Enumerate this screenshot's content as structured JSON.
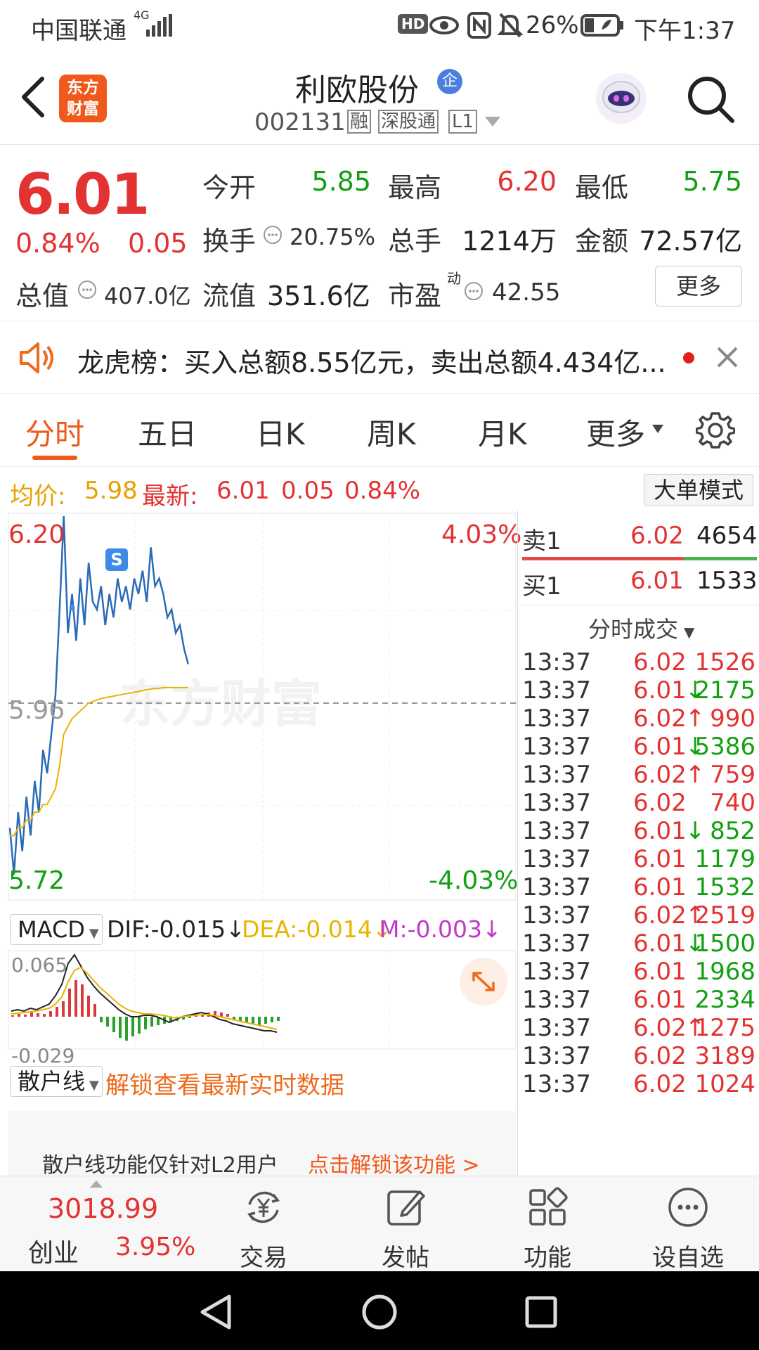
{
  "status_bar": {
    "carrier": "中国联通",
    "net": "4G",
    "battery": "26%",
    "time": "下午1:37",
    "hd": "HD"
  },
  "header": {
    "title": "利欧股份",
    "badge": "企",
    "code": "002131",
    "tags": [
      "融",
      "深股通",
      "L1"
    ],
    "logo_line1": "东方",
    "logo_line2": "财富"
  },
  "quote": {
    "price": "6.01",
    "change_pct": "0.84%",
    "change": "0.05",
    "open_label": "今开",
    "open": "5.85",
    "high_label": "最高",
    "high": "6.20",
    "low_label": "最低",
    "low": "5.75",
    "turnover_label": "换手",
    "turnover": "20.75%",
    "volume_label": "总手",
    "volume": "1214万",
    "amount_label": "金额",
    "amount": "72.57亿",
    "mcap_label": "总值",
    "mcap": "407.0亿",
    "float_label": "流值",
    "float": "351.6亿",
    "pe_label": "市盈",
    "pe_sup": "动",
    "pe": "42.55",
    "more": "更多"
  },
  "notice": {
    "text": "龙虎榜：买入总额8.55亿元，卖出总额4.434亿..."
  },
  "tabs": [
    "分时",
    "五日",
    "日K",
    "周K",
    "月K",
    "更多"
  ],
  "info": {
    "avg_label": "均价:",
    "avg": "5.98",
    "latest_label": "最新:",
    "latest": "6.01",
    "change": "0.05",
    "pct": "0.84%",
    "big_order": "大单模式"
  },
  "chart_labels": {
    "top_price": "6.20",
    "top_pct": "4.03%",
    "mid": "5.96",
    "bot_price": "5.72",
    "bot_pct": "-4.03%",
    "s_marker": "S",
    "watermark": "东方财富"
  },
  "macd": {
    "name": "MACD",
    "dif": "DIF:-0.015",
    "dea": "DEA:-0.014",
    "m": "M:-0.003",
    "top": "0.065",
    "bottom": "-0.029"
  },
  "retail": {
    "name": "散户线",
    "unlock": "解锁查看最新实时数据",
    "msg": "散户线功能仅针对L2用户",
    "link": "点击解锁该功能 >"
  },
  "order_book": {
    "sell1_label": "卖1",
    "sell1_price": "6.02",
    "sell1_vol": "4654",
    "buy1_label": "买1",
    "buy1_price": "6.01",
    "buy1_vol": "1533",
    "trades_header": "分时成交"
  },
  "trades": [
    {
      "time": "13:37",
      "price": "6.02",
      "arrow": "",
      "vol": "1526",
      "color": "red"
    },
    {
      "time": "13:37",
      "price": "6.01",
      "arrow": "↓",
      "vol": "2175",
      "color": "green"
    },
    {
      "time": "13:37",
      "price": "6.02",
      "arrow": "↑",
      "vol": "990",
      "color": "red"
    },
    {
      "time": "13:37",
      "price": "6.01",
      "arrow": "↓",
      "vol": "5386",
      "color": "green"
    },
    {
      "time": "13:37",
      "price": "6.02",
      "arrow": "↑",
      "vol": "759",
      "color": "red"
    },
    {
      "time": "13:37",
      "price": "6.02",
      "arrow": "",
      "vol": "740",
      "color": "red"
    },
    {
      "time": "13:37",
      "price": "6.01",
      "arrow": "↓",
      "vol": "852",
      "color": "green"
    },
    {
      "time": "13:37",
      "price": "6.01",
      "arrow": "",
      "vol": "1179",
      "color": "green"
    },
    {
      "time": "13:37",
      "price": "6.01",
      "arrow": "",
      "vol": "1532",
      "color": "green"
    },
    {
      "time": "13:37",
      "price": "6.02",
      "arrow": "↑",
      "vol": "2519",
      "color": "red"
    },
    {
      "time": "13:37",
      "price": "6.01",
      "arrow": "↓",
      "vol": "1500",
      "color": "green"
    },
    {
      "time": "13:37",
      "price": "6.01",
      "arrow": "",
      "vol": "1968",
      "color": "green"
    },
    {
      "time": "13:37",
      "price": "6.01",
      "arrow": "",
      "vol": "2334",
      "color": "green"
    },
    {
      "time": "13:37",
      "price": "6.02",
      "arrow": "↑",
      "vol": "1275",
      "color": "red"
    },
    {
      "time": "13:37",
      "price": "6.02",
      "arrow": "",
      "vol": "3189",
      "color": "red"
    },
    {
      "time": "13:37",
      "price": "6.02",
      "arrow": "",
      "vol": "1024",
      "color": "red"
    }
  ],
  "bottom_nav": {
    "index_value": "3018.99",
    "index_name": "创业",
    "index_pct": "3.95%",
    "items": [
      "交易",
      "发帖",
      "功能",
      "设自选"
    ]
  },
  "chart_data": {
    "type": "line",
    "title": "",
    "ylim": [
      5.72,
      6.2
    ],
    "base": 5.96,
    "series": [
      {
        "values": [
          5.8,
          5.74,
          5.82,
          5.77,
          5.84,
          5.79,
          5.86,
          5.82,
          5.9,
          5.87,
          5.92,
          5.97,
          6.08,
          6.2,
          6.05,
          6.1,
          6.04,
          6.12,
          6.06,
          6.14,
          6.09,
          6.08,
          6.11,
          6.06,
          6.1,
          6.07,
          6.12,
          6.09,
          6.11,
          6.08,
          6.12,
          6.1,
          6.13,
          6.09,
          6.16,
          6.11,
          6.12,
          6.1,
          6.07,
          6.08,
          6.05,
          6.06,
          6.03,
          6.01
        ]
      },
      {
        "values": [
          5.79,
          5.79,
          5.8,
          5.8,
          5.81,
          5.81,
          5.82,
          5.82,
          5.83,
          5.83,
          5.84,
          5.85,
          5.88,
          5.92,
          5.93,
          5.94,
          5.945,
          5.95,
          5.955,
          5.96,
          5.962,
          5.964,
          5.966,
          5.967,
          5.968,
          5.969,
          5.97,
          5.971,
          5.972,
          5.973,
          5.974,
          5.975,
          5.976,
          5.977,
          5.978,
          5.979,
          5.979,
          5.98,
          5.98,
          5.98,
          5.98,
          5.98,
          5.98,
          5.98
        ]
      }
    ]
  }
}
